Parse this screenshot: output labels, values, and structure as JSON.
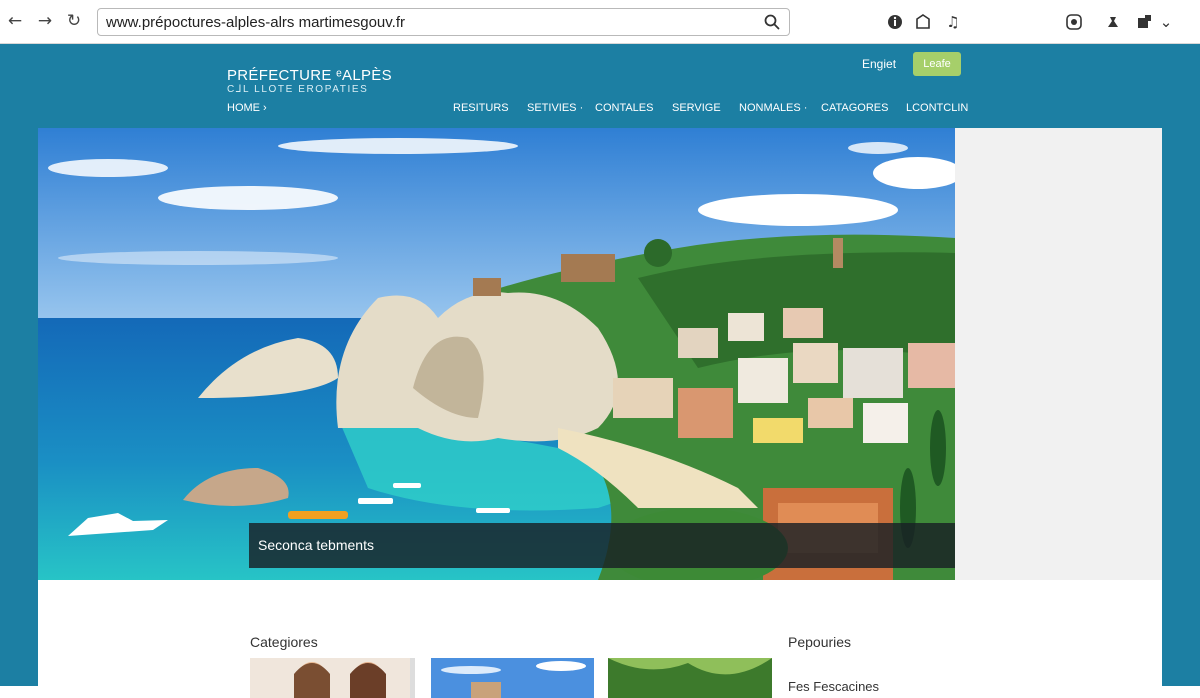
{
  "browser": {
    "url": "www.prépoctures-alples-alrs martimesgouv.fr",
    "icons": [
      "back-arrow-icon",
      "forward-arrow-icon",
      "reload-icon",
      "search-icon",
      "info-icon",
      "shield-icon",
      "music-icon",
      "extension-icon",
      "pin-icon",
      "profile-icon",
      "menu-icon"
    ]
  },
  "site": {
    "logo_title": "PRÉFECTURE ᵉALPÈS",
    "logo_sub": "C⅃L LLOTE EROPATIES",
    "home": "HOME ›",
    "top_link": "Engiet",
    "top_button": "Leafe",
    "menu": [
      "RESITURS",
      "SETIVIES ·",
      "CONTALES",
      "SERVIGE",
      "NONMALES ·",
      "CATAGORES",
      "LCONTCLIN"
    ],
    "accent_color": "#1c7fa3",
    "button_color": "#a6cf6a"
  },
  "hero": {
    "caption": "Seconca tebments"
  },
  "content": {
    "left_title": "Categiores",
    "right_title": "Pepouries",
    "right_item": "Fes Fescacines"
  }
}
